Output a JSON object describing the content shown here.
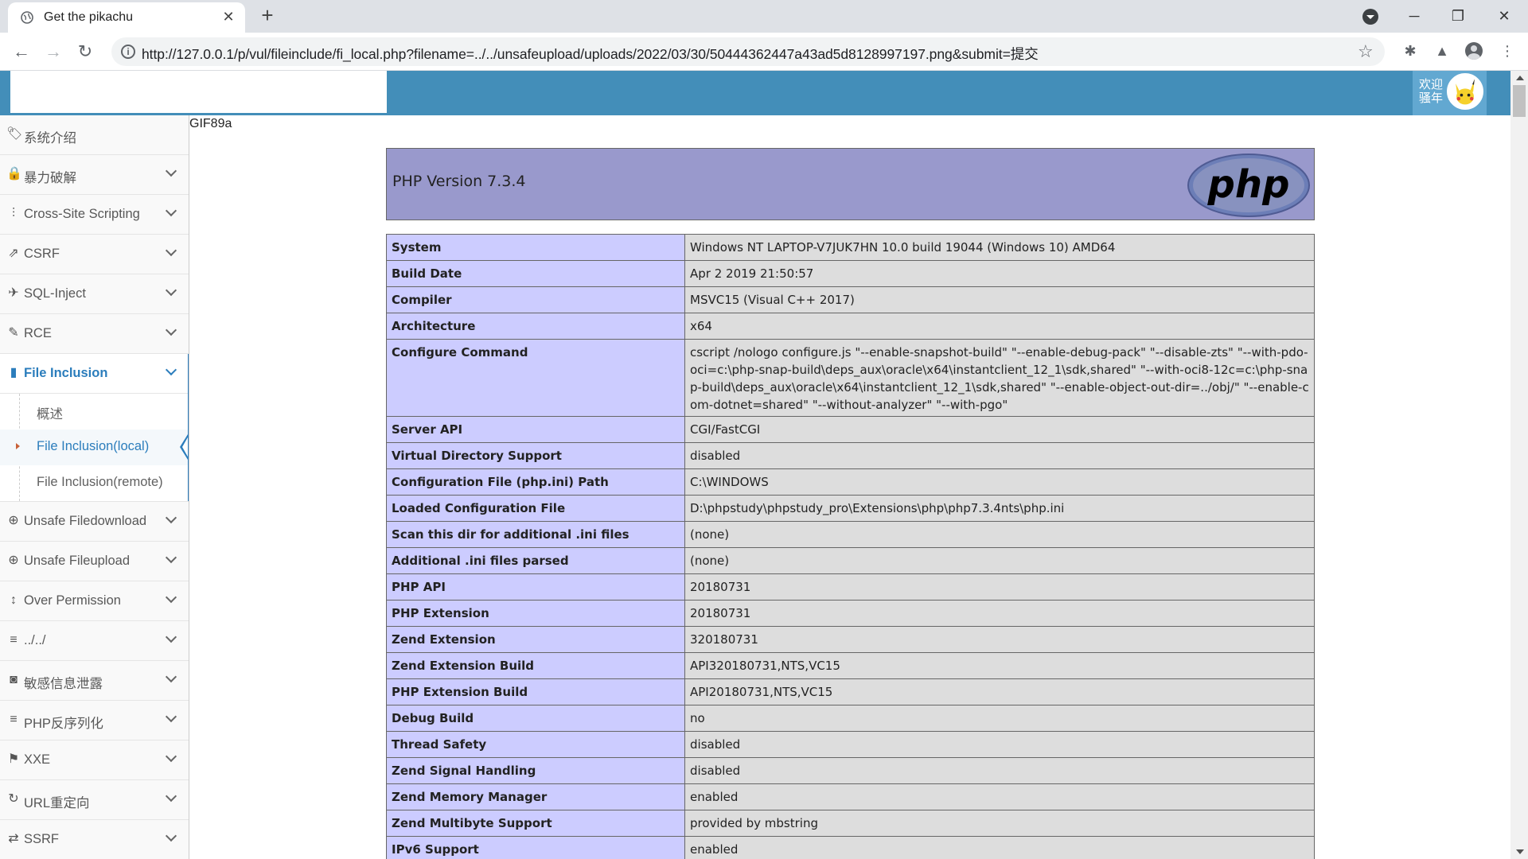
{
  "browser": {
    "tab_title": "Get the pikachu",
    "url": "http://127.0.0.1/p/vul/fileinclude/fi_local.php?filename=../../unsafeupload/uploads/2022/03/30/50444362447a43ad5d8128997197.png&submit=提交"
  },
  "header": {
    "welcome_text": "欢迎骚年"
  },
  "sidebar": {
    "items": [
      {
        "label": "系统介绍",
        "icon": "tags-icon"
      },
      {
        "label": "暴力破解",
        "icon": "lock-icon"
      },
      {
        "label": "Cross-Site Scripting",
        "icon": "align-icon"
      },
      {
        "label": "CSRF",
        "icon": "share-icon"
      },
      {
        "label": "SQL-Inject",
        "icon": "plane-icon"
      },
      {
        "label": "RCE",
        "icon": "pencil-icon"
      },
      {
        "label": "File Inclusion",
        "icon": "file-icon"
      },
      {
        "label": "Unsafe Filedownload",
        "icon": "download-circle-icon"
      },
      {
        "label": "Unsafe Fileupload",
        "icon": "upload-circle-icon"
      },
      {
        "label": "Over Permission",
        "icon": "text-height-icon"
      },
      {
        "label": "../../",
        "icon": "list-icon"
      },
      {
        "label": "敏感信息泄露",
        "icon": "camera-icon"
      },
      {
        "label": "PHP反序列化",
        "icon": "list-icon"
      },
      {
        "label": "XXE",
        "icon": "flag-icon"
      },
      {
        "label": "URL重定向",
        "icon": "refresh-icon"
      },
      {
        "label": "SSRF",
        "icon": "exchange-icon"
      }
    ],
    "file_inclusion_sub": [
      {
        "label": "概述"
      },
      {
        "label": "File Inclusion(local)"
      },
      {
        "label": "File Inclusion(remote)"
      }
    ]
  },
  "content": {
    "gif_header": "GIF89a",
    "php_version": "PHP Version 7.3.4",
    "php_logo_text": "php",
    "rows": [
      {
        "key": "System",
        "value": "Windows NT LAPTOP-V7JUK7HN 10.0 build 19044 (Windows 10) AMD64"
      },
      {
        "key": "Build Date",
        "value": "Apr 2 2019 21:50:57"
      },
      {
        "key": "Compiler",
        "value": "MSVC15 (Visual C++ 2017)"
      },
      {
        "key": "Architecture",
        "value": "x64"
      },
      {
        "key": "Configure Command",
        "value": "cscript /nologo configure.js \"--enable-snapshot-build\" \"--enable-debug-pack\" \"--disable-zts\" \"--with-pdo-oci=c:\\php-snap-build\\deps_aux\\oracle\\x64\\instantclient_12_1\\sdk,shared\" \"--with-oci8-12c=c:\\php-snap-build\\deps_aux\\oracle\\x64\\instantclient_12_1\\sdk,shared\" \"--enable-object-out-dir=../obj/\" \"--enable-com-dotnet=shared\" \"--without-analyzer\" \"--with-pgo\""
      },
      {
        "key": "Server API",
        "value": "CGI/FastCGI"
      },
      {
        "key": "Virtual Directory Support",
        "value": "disabled"
      },
      {
        "key": "Configuration File (php.ini) Path",
        "value": "C:\\WINDOWS"
      },
      {
        "key": "Loaded Configuration File",
        "value": "D:\\phpstudy\\phpstudy_pro\\Extensions\\php\\php7.3.4nts\\php.ini"
      },
      {
        "key": "Scan this dir for additional .ini files",
        "value": "(none)"
      },
      {
        "key": "Additional .ini files parsed",
        "value": "(none)"
      },
      {
        "key": "PHP API",
        "value": "20180731"
      },
      {
        "key": "PHP Extension",
        "value": "20180731"
      },
      {
        "key": "Zend Extension",
        "value": "320180731"
      },
      {
        "key": "Zend Extension Build",
        "value": "API320180731,NTS,VC15"
      },
      {
        "key": "PHP Extension Build",
        "value": "API20180731,NTS,VC15"
      },
      {
        "key": "Debug Build",
        "value": "no"
      },
      {
        "key": "Thread Safety",
        "value": "disabled"
      },
      {
        "key": "Zend Signal Handling",
        "value": "disabled"
      },
      {
        "key": "Zend Memory Manager",
        "value": "enabled"
      },
      {
        "key": "Zend Multibyte Support",
        "value": "provided by mbstring"
      },
      {
        "key": "IPv6 Support",
        "value": "enabled"
      }
    ]
  },
  "colors": {
    "header_blue": "#438eb9",
    "active_blue": "#2b7dbc",
    "php_purple": "#9999cc",
    "key_cell": "#ccccff",
    "value_cell": "#dddddd"
  }
}
